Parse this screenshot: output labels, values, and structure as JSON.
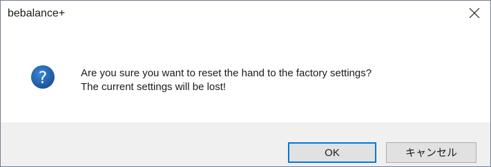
{
  "window": {
    "title": "bebalance+"
  },
  "dialog": {
    "icon": "question-icon",
    "message_line1": "Are you sure you want to reset the hand to the factory settings?",
    "message_line2": "The current settings will be lost!"
  },
  "buttons": {
    "ok_label": "OK",
    "cancel_label": "キャンセル"
  },
  "colors": {
    "icon_blue": "#1e5fa8",
    "focus_border": "#0078d7",
    "footer_bg": "#f0f0f0",
    "button_bg": "#e1e1e1"
  }
}
